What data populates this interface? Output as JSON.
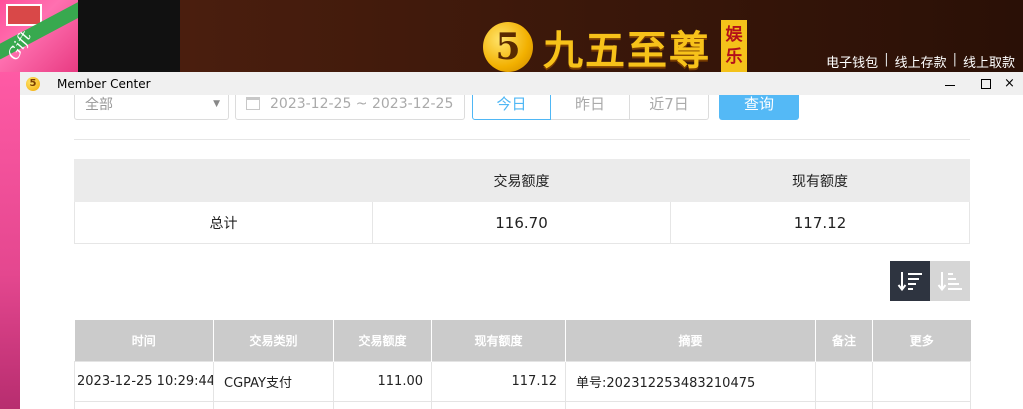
{
  "site": {
    "logo_char": "5",
    "logo_text": "九五至尊",
    "logo_badge": "娱乐",
    "top_links": [
      "电子钱包",
      "线上存款",
      "线上取款"
    ],
    "promo_script": "Gift"
  },
  "window": {
    "title": "Member Center",
    "close_glyph": "×"
  },
  "filters": {
    "type_select": "全部",
    "date_range": "2023-12-25 ~ 2023-12-25",
    "quick_ranges": [
      "今日",
      "昨日",
      "近7日"
    ],
    "active_range": "今日",
    "query_label": "查询"
  },
  "summary": {
    "headers": [
      "",
      "交易额度",
      "现有额度"
    ],
    "row_label": "总计",
    "trade_total": "116.70",
    "balance_total": "117.12"
  },
  "detail": {
    "headers": [
      "时间",
      "交易类别",
      "交易额度",
      "现有额度",
      "摘要",
      "备注",
      "更多"
    ],
    "rows": [
      {
        "time": "2023-12-25 10:29:44",
        "category": "CGPAY支付",
        "amount": "111.00",
        "balance": "117.12",
        "summary": "单号:202312253483210475",
        "note": "",
        "more": ""
      }
    ]
  },
  "colors": {
    "accent": "#54b9f6",
    "sort_active": "#2e3440",
    "table_header": "#cbcbcb"
  }
}
